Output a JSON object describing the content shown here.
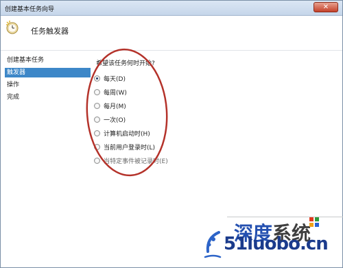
{
  "window": {
    "title": "创建基本任务向导",
    "close_label": "✕"
  },
  "header": {
    "icon": "clock-icon",
    "heading": "任务触发器"
  },
  "sidebar": {
    "items": [
      {
        "label": "创建基本任务",
        "active": false
      },
      {
        "label": "触发器",
        "active": true
      },
      {
        "label": "操作",
        "active": false
      },
      {
        "label": "完成",
        "active": false
      }
    ]
  },
  "main": {
    "prompt": "希望该任务何时开始?",
    "options": [
      {
        "label": "每天(D)",
        "checked": true
      },
      {
        "label": "每周(W)",
        "checked": false
      },
      {
        "label": "每月(M)",
        "checked": false
      },
      {
        "label": "一次(O)",
        "checked": false
      },
      {
        "label": "计算机启动时(H)",
        "checked": false
      },
      {
        "label": "当前用户登录时(L)",
        "checked": false
      },
      {
        "label": "当特定事件被记录时(E)",
        "checked": false
      }
    ]
  },
  "annotation": {
    "shape": "ellipse",
    "color": "#b4322a"
  },
  "watermark": {
    "brand_latin": "51luobo.cn",
    "brand_cn_1": "深度",
    "brand_cn_2": "系统",
    "colors": {
      "blue": "#2450b0",
      "gray": "#3f3f3f"
    }
  }
}
